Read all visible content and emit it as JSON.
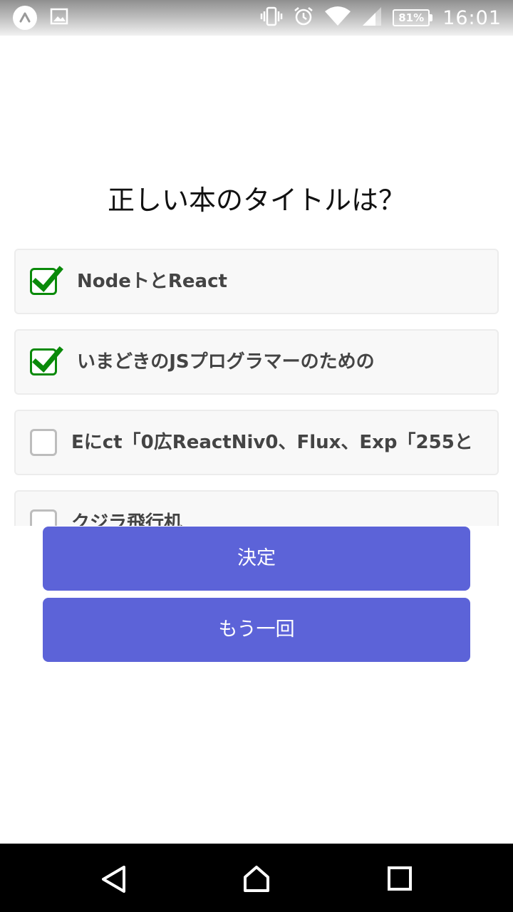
{
  "status_bar": {
    "battery": "81%",
    "time": "16:01",
    "icons": [
      "app-a-icon",
      "image-icon",
      "vibrate-icon",
      "alarm-icon",
      "wifi-icon",
      "signal-icon",
      "battery-icon"
    ]
  },
  "quiz": {
    "question": "正しい本のタイトルは？",
    "options": [
      {
        "label": "NodeトとReact",
        "checked": true
      },
      {
        "label": "いまどきのJSプログラマーのための",
        "checked": true
      },
      {
        "label": "Eにct「0広ReactNiv0、Flux、Exp「255と",
        "checked": false
      },
      {
        "label": "クジラ飛行机",
        "checked": false
      }
    ]
  },
  "buttons": {
    "submit_label": "決定",
    "retry_label": "もう一回"
  },
  "colors": {
    "button": "#5c63d8",
    "check": "#0a8a0a",
    "option_bg": "#f8f8f8"
  }
}
